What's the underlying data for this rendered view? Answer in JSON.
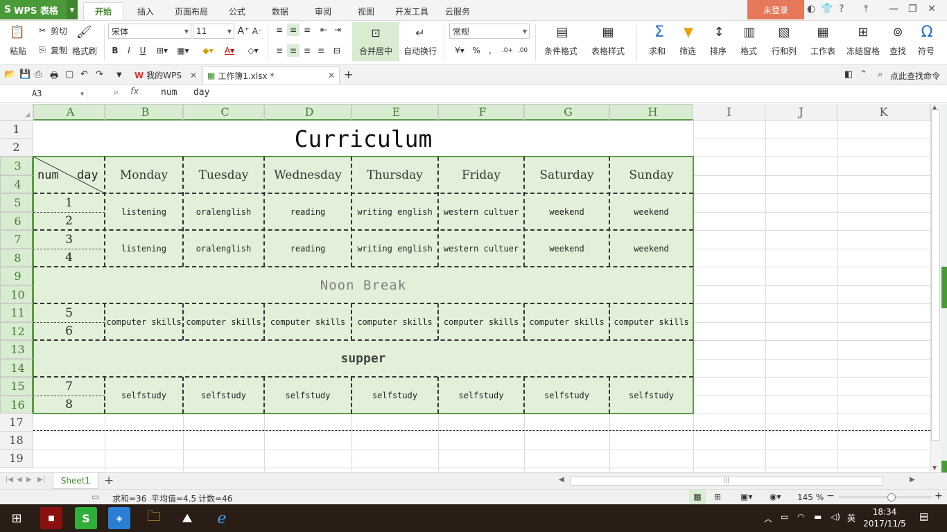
{
  "titlebar": {
    "app_name": "WPS 表格",
    "tabs": [
      "开始",
      "插入",
      "页面布局",
      "公式",
      "数据",
      "审阅",
      "视图",
      "开发工具",
      "云服务"
    ],
    "active_tab": "开始",
    "login_label": "未登录"
  },
  "ribbon": {
    "paste": "粘贴",
    "cut": "剪切",
    "copy": "复制",
    "format_painter": "格式刷",
    "font_name": "宋体",
    "font_size": "11",
    "merge_center": "合并居中",
    "wrap_text": "自动换行",
    "number_format": "常规",
    "conditional_format": "条件格式",
    "table_style": "表格样式",
    "sum": "求和",
    "filter": "筛选",
    "sort": "排序",
    "format": "格式",
    "row_col": "行和列",
    "worksheet": "工作表",
    "freeze": "冻结窗格",
    "find": "查找",
    "symbol": "符号",
    "percent": "%",
    "thousands": "000"
  },
  "quickbar": {
    "doc_tabs": [
      {
        "label": "我的WPS"
      },
      {
        "label": "工作簿1.xlsx *"
      }
    ],
    "search_label": "点此查找命令"
  },
  "formula_bar": {
    "cell_ref": "A3",
    "fx": "fx",
    "content": "num   day"
  },
  "columns": [
    "A",
    "B",
    "C",
    "D",
    "E",
    "F",
    "G",
    "H",
    "I",
    "J",
    "K"
  ],
  "rows": [
    "1",
    "2",
    "3",
    "4",
    "5",
    "6",
    "7",
    "8",
    "9",
    "10",
    "11",
    "12",
    "13",
    "14",
    "15",
    "16",
    "17",
    "18",
    "19"
  ],
  "sheet": {
    "title": "Curriculum",
    "corner_left": "num",
    "corner_right": "day",
    "days": [
      "Monday",
      "Tuesday",
      "Wednesday",
      "Thursday",
      "Friday",
      "Saturday",
      "Sunday"
    ],
    "numbers": [
      "1",
      "2",
      "3",
      "4",
      "5",
      "6",
      "7",
      "8"
    ],
    "block1": [
      "listening",
      "oralenglish",
      "reading",
      "writing english",
      "western cultuer",
      "weekend",
      "weekend"
    ],
    "block2": [
      "listening",
      "oralenglish",
      "reading",
      "writing english",
      "western cultuer",
      "weekend",
      "weekend"
    ],
    "noon": "Noon Break",
    "block3": [
      "computer skills",
      "computer skills",
      "computer skills",
      "computer skills",
      "computer skills",
      "computer skills",
      "computer skills"
    ],
    "supper": "supper",
    "block4": [
      "selfstudy",
      "selfstudy",
      "selfstudy",
      "selfstudy",
      "selfstudy",
      "selfstudy",
      "selfstudy"
    ]
  },
  "sheet_tabs": {
    "active": "Sheet1",
    "add": "+"
  },
  "statusbar": {
    "sum": "求和=36",
    "average": "平均值=4.5",
    "count": "计数=46",
    "zoom": "145 %"
  },
  "taskbar": {
    "time": "18:34",
    "date": "2017/11/5",
    "ime": "英"
  },
  "colors": {
    "brand_green": "#4a9a37",
    "table_fill": "#e2f0d9",
    "table_border": "#5b9a46",
    "login_bg": "#e6785a"
  }
}
